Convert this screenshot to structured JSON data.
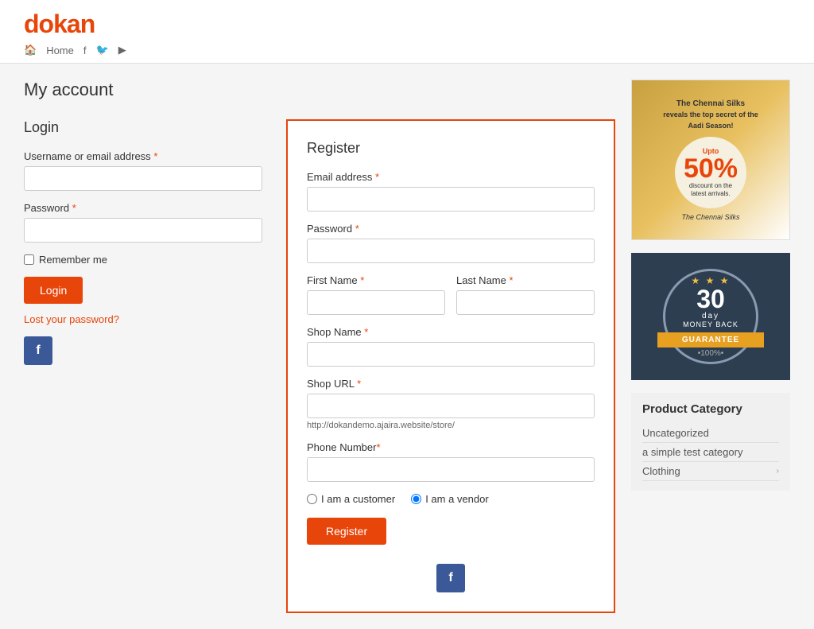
{
  "site": {
    "logo_text": "dokan",
    "logo_accent": "d"
  },
  "nav": {
    "home_label": "Home",
    "home_icon": "🏠",
    "facebook_icon": "f",
    "twitter_icon": "t",
    "youtube_icon": "▶"
  },
  "page": {
    "title": "My account"
  },
  "login": {
    "section_title": "Login",
    "username_label": "Username or email address",
    "password_label": "Password",
    "remember_label": "Remember me",
    "login_btn": "Login",
    "lost_password": "Lost your password?",
    "facebook_btn": "f"
  },
  "register": {
    "section_title": "Register",
    "email_label": "Email address",
    "password_label": "Password",
    "first_name_label": "First Name",
    "last_name_label": "Last Name",
    "shop_name_label": "Shop Name",
    "shop_url_label": "Shop URL",
    "shop_url_hint": "http://dokandemo.ajaira.website/store/",
    "phone_label": "Phone Number",
    "customer_radio": "I am a customer",
    "vendor_radio": "I am a vendor",
    "register_btn": "Register",
    "facebook_btn": "f"
  },
  "ad_banner": {
    "top_text": "The Chennai Silks\nreveals the top secret of the\nAadi Season!",
    "percent": "50%",
    "discount_text": "discount on the\nlatest arrivals.",
    "brand": "The Chennai Silks"
  },
  "guarantee": {
    "days": "30",
    "day_label": "day",
    "money_back": "MONEY BACK",
    "guarantee_label": "GUARANTEE",
    "percent": "•100%•"
  },
  "product_category": {
    "title": "Product Category",
    "items": [
      {
        "label": "Uncategorized",
        "has_arrow": false
      },
      {
        "label": "a simple test category",
        "has_arrow": false
      },
      {
        "label": "Clothing",
        "has_arrow": true
      }
    ]
  }
}
